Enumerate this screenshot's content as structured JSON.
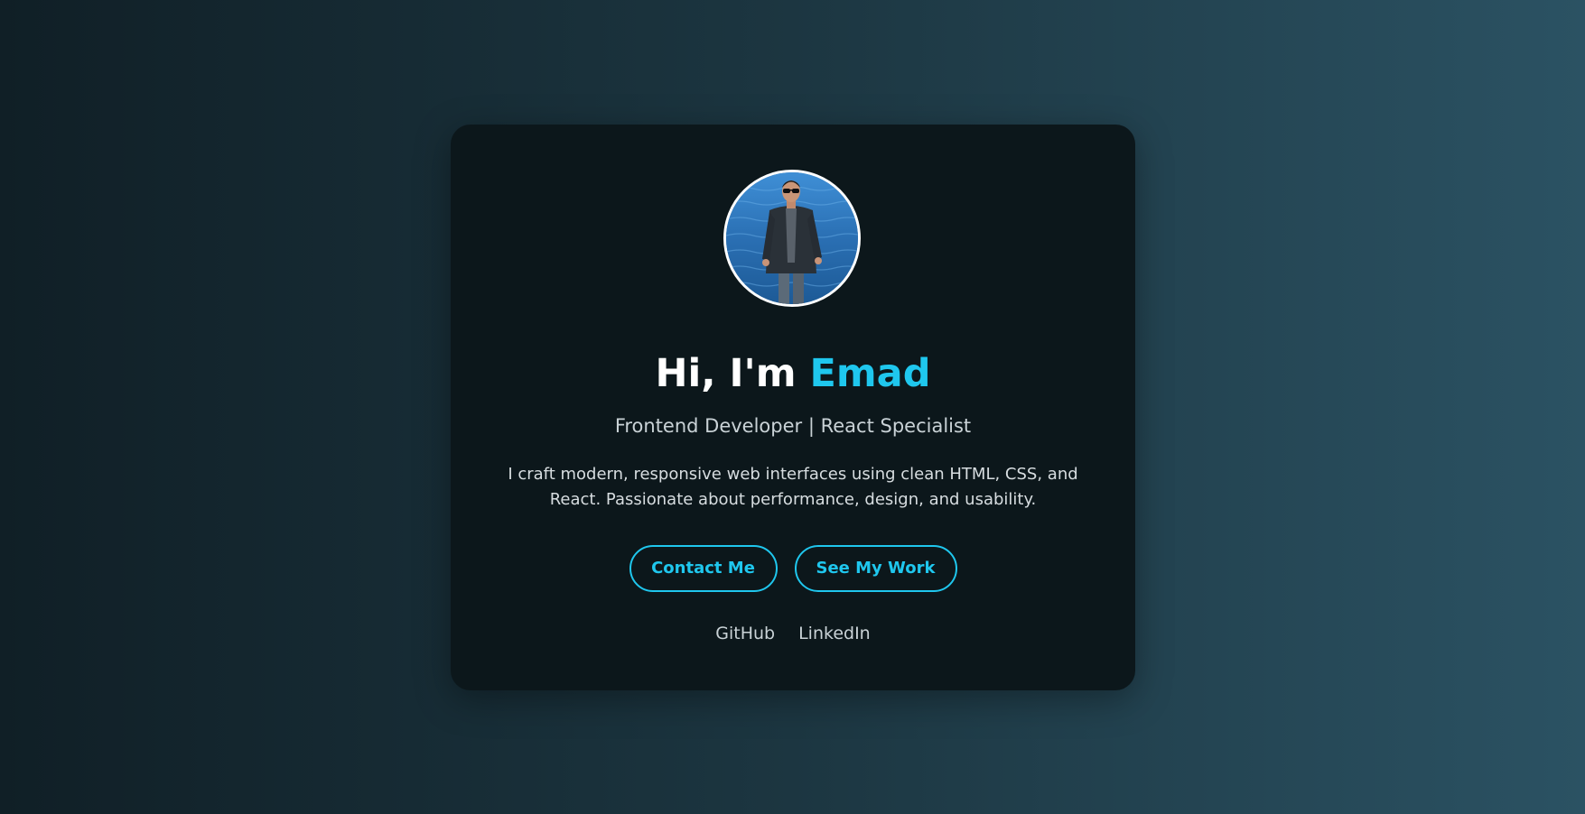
{
  "profile": {
    "greeting": "Hi, I'm ",
    "name": "Emad",
    "subtitle": "Frontend Developer | React Specialist",
    "bio": "I craft modern, responsive web interfaces using clean HTML, CSS, and React. Passionate about performance, design, and usability.",
    "avatar_alt": "profile photo of man in sunglasses by the sea"
  },
  "actions": {
    "contact_label": "Contact Me",
    "work_label": "See My Work"
  },
  "links": {
    "github_label": "GitHub",
    "linkedin_label": "LinkedIn"
  },
  "colors": {
    "accent": "#1fc7ee",
    "card_background": "#0c171b",
    "page_gradient_start": "#101f26",
    "page_gradient_end": "#2b5263",
    "heading_text": "#ffffff",
    "muted_text": "#c9d2d6"
  }
}
